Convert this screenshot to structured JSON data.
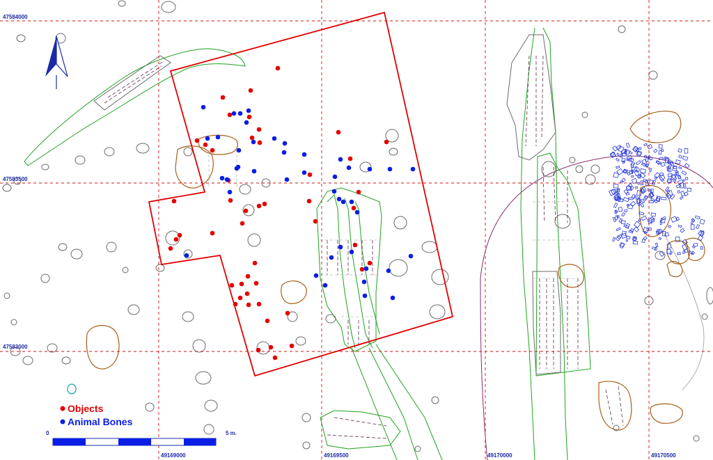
{
  "grid": {
    "y_labels": [
      "47584000",
      "47583500",
      "47583000"
    ],
    "x_labels": [
      "49169000",
      "49169500",
      "49170000",
      "49170500"
    ]
  },
  "legend": {
    "objects_label": "Objects",
    "objects_color": "#e60000",
    "bones_label": "Animal Bones",
    "bones_color": "#0a1ee6"
  },
  "scale_bar": {
    "start_label": "0",
    "end_label": "5 m."
  },
  "north_arrow": {
    "icon": "north-arrow-icon"
  },
  "colors": {
    "grid": "#d01010",
    "excavation_boundary": "#e00000",
    "feature_outline_green": "#1fa31f",
    "feature_outline_brown": "#a5601a",
    "stone_outline": "#888888",
    "bone_scatter": "#2a3bd8",
    "ditch_purple": "#8a2a6a",
    "coords": "#1a2aa8"
  }
}
